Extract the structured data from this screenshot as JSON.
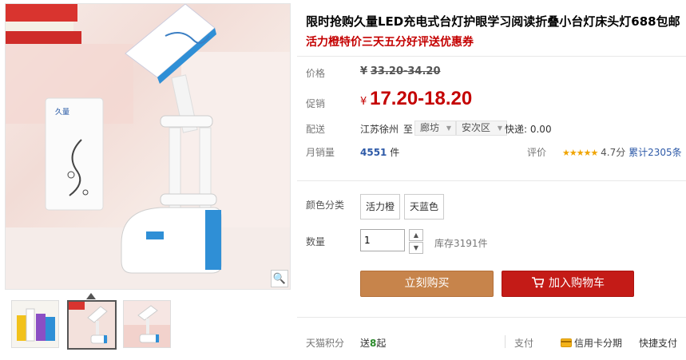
{
  "product": {
    "title": "限时抢购久量LED充电式台灯护眼学习阅读折叠小台灯床头灯688包邮",
    "subtitle": "活力橙特价三天五分好评送优惠券"
  },
  "price": {
    "label": "价格",
    "currency": "¥",
    "original": "33.20-34.20"
  },
  "promo": {
    "label": "促销",
    "currency": "¥",
    "price": "17.20-18.20"
  },
  "shipping": {
    "label": "配送",
    "origin": "江苏徐州",
    "to": "至",
    "city": "廊坊",
    "district": "安次区",
    "fee": "快递: 0.00"
  },
  "sales": {
    "label": "月销量",
    "count": "4551",
    "unit": "件"
  },
  "rating": {
    "label": "评价",
    "stars": "★★★★★",
    "score": "4.7分",
    "total": "累计2305条"
  },
  "sku": {
    "label": "颜色分类",
    "options": [
      "活力橙",
      "天蓝色"
    ]
  },
  "quantity": {
    "label": "数量",
    "value": "1",
    "up": "▲",
    "down": "▼",
    "stock": "库存3191件"
  },
  "actions": {
    "buy": "立刻购买",
    "cart": "加入购物车"
  },
  "footer": {
    "points_label": "天猫积分",
    "points_value": "送8起",
    "payment_label": "支付",
    "credit": "信用卡分期",
    "quick": "快捷支付"
  },
  "icons": {
    "zoom": "magnifier-icon",
    "cart": "cart-icon",
    "card": "credit-card-icon"
  },
  "colors": {
    "accent_red": "#c40000",
    "buy_orange": "#c7844b",
    "cart_red": "#c41b17",
    "link_blue": "#2e5aa8"
  }
}
